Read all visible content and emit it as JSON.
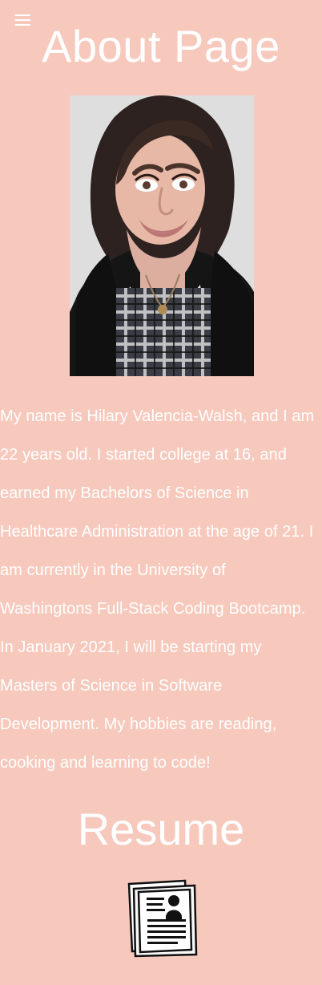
{
  "page": {
    "title": "About Page"
  },
  "menu": {
    "icon": "hamburger-menu-icon"
  },
  "profile": {
    "photo_alt": "Profile photo of Hilary Valencia-Walsh"
  },
  "about": {
    "bio": "My name is Hilary Valencia-Walsh, and I am 22 years old. I started college at 16, and earned my Bachelors of Science in Healthcare Administration at the age of 21. I am currently in the University of Washingtons Full-Stack Coding Bootcamp. In January 2021, I will be starting my Masters of Science in Software Development. My hobbies are reading, cooking and learning to code!"
  },
  "resume": {
    "title": "Resume",
    "icon": "resume-document-icon"
  },
  "colors": {
    "background": "#f7c9bd",
    "text": "#ffffff"
  }
}
